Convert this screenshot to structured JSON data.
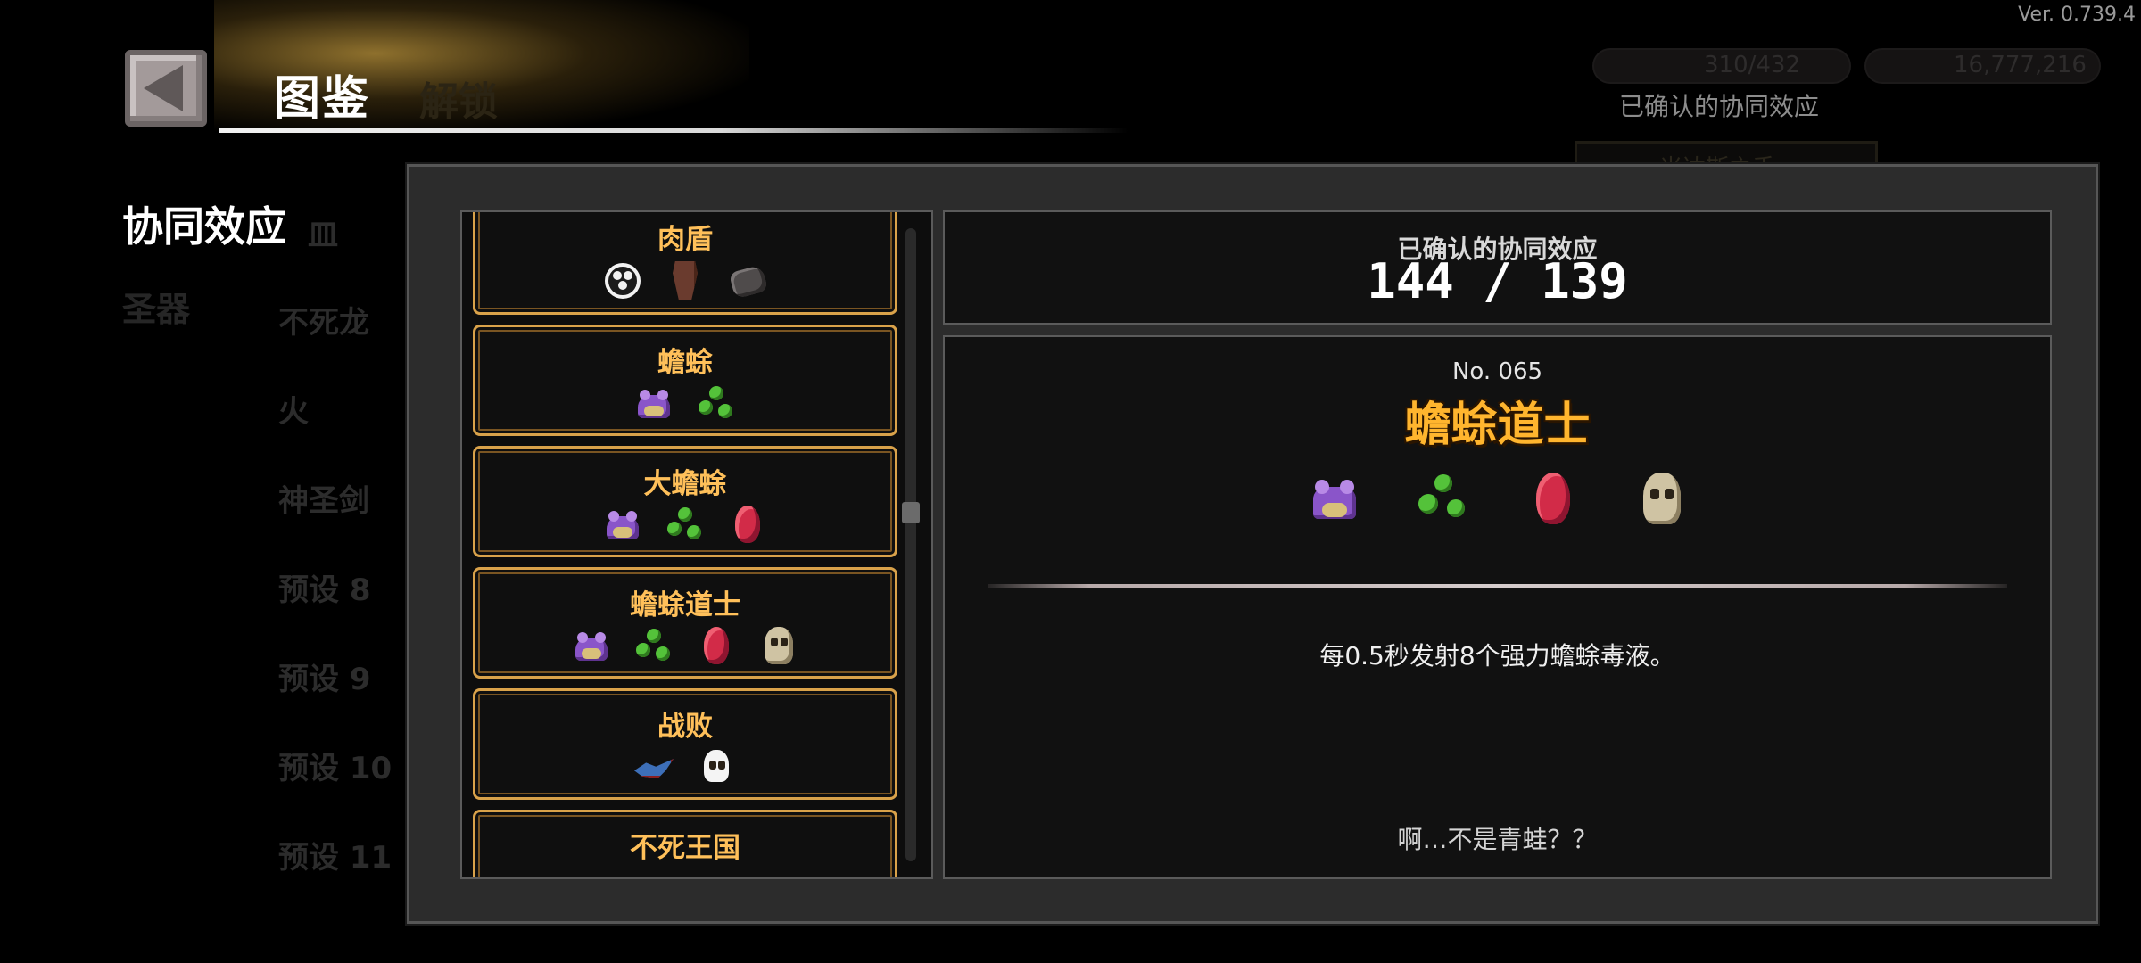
{
  "version": "Ver. 0.739.4",
  "header": {
    "title": "图鉴",
    "ghost_tab": "解锁"
  },
  "background": {
    "confirmed_label": "已确认的协同效应",
    "currency1": "310/432",
    "currency2": "16,777,216",
    "dim_card": "米达斯之手",
    "side_tabs": [
      "协同效应",
      "圣器"
    ],
    "dim_list": [
      "皿",
      "不死龙",
      "火",
      "神圣剑",
      "预设 8",
      "预设 9",
      "预设 10",
      "预设 11"
    ]
  },
  "synergy_list": [
    {
      "title": "肉盾",
      "icons": [
        "shield-icon",
        "cloak-icon",
        "stone-icon"
      ]
    },
    {
      "title": "蟾蜍",
      "icons": [
        "frog-icon",
        "slime-icon"
      ]
    },
    {
      "title": "大蟾蜍",
      "icons": [
        "frog-icon",
        "slime-icon",
        "red-egg-icon"
      ]
    },
    {
      "title": "蟾蜍道士",
      "icons": [
        "frog-icon",
        "slime-icon",
        "red-egg-icon",
        "skull-icon"
      ]
    },
    {
      "title": "战败",
      "icons": [
        "dragon-icon",
        "white-skull-icon"
      ]
    },
    {
      "title": "不死王国",
      "icons": []
    }
  ],
  "summary": {
    "label": "已确认的协同效应",
    "value": "144 / 139"
  },
  "detail": {
    "number": "No. 065",
    "name": "蟾蜍道士",
    "icons": [
      "frog-icon",
      "slime-icon",
      "red-egg-icon",
      "skull-icon"
    ],
    "description": "每0.5秒发射8个强力蟾蜍毒液。",
    "flavor": "啊…不是青蛙？？"
  },
  "colors": {
    "accent": "#ffc05a",
    "card_border": "#d9a24a",
    "panel_bg": "#2c2c2c",
    "name_color": "#ffb52e"
  }
}
